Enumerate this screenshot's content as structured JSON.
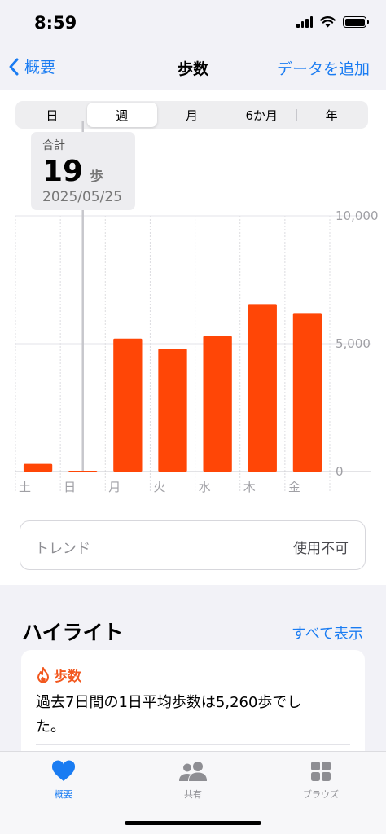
{
  "status": {
    "time": "8:59"
  },
  "nav": {
    "back_label": "概要",
    "title": "歩数",
    "add_label": "データを追加"
  },
  "segments": [
    "日",
    "週",
    "月",
    "6か月",
    "年"
  ],
  "selected_segment": "週",
  "tooltip": {
    "label": "合計",
    "value": "19",
    "unit": "歩",
    "date": "2025/05/25"
  },
  "chart_data": {
    "type": "bar",
    "categories": [
      "土",
      "日",
      "月",
      "火",
      "水",
      "木",
      "金"
    ],
    "values": [
      300,
      19,
      5200,
      4800,
      5300,
      6550,
      6200
    ],
    "y_ticks": [
      10000,
      5000,
      0
    ],
    "y_tick_labels": [
      "10,000",
      "5,000",
      "0"
    ],
    "ylim": [
      0,
      10000
    ],
    "color": "#ff4606",
    "grid": true
  },
  "trend": {
    "label": "トレンド",
    "value": "使用不可"
  },
  "highlights": {
    "title": "ハイライト",
    "see_all": "すべて表示",
    "card": {
      "title": "歩数",
      "text": "過去7日間の1日平均歩数は5,260歩でした。"
    }
  },
  "tabs": [
    {
      "label": "概要",
      "icon": "heart-icon",
      "active": true
    },
    {
      "label": "共有",
      "icon": "people-icon",
      "active": false
    },
    {
      "label": "ブラウズ",
      "icon": "grid-icon",
      "active": false
    }
  ],
  "colors": {
    "accent": "#1a7cf2",
    "bar": "#ff4606",
    "highlight": "#f2581f"
  }
}
